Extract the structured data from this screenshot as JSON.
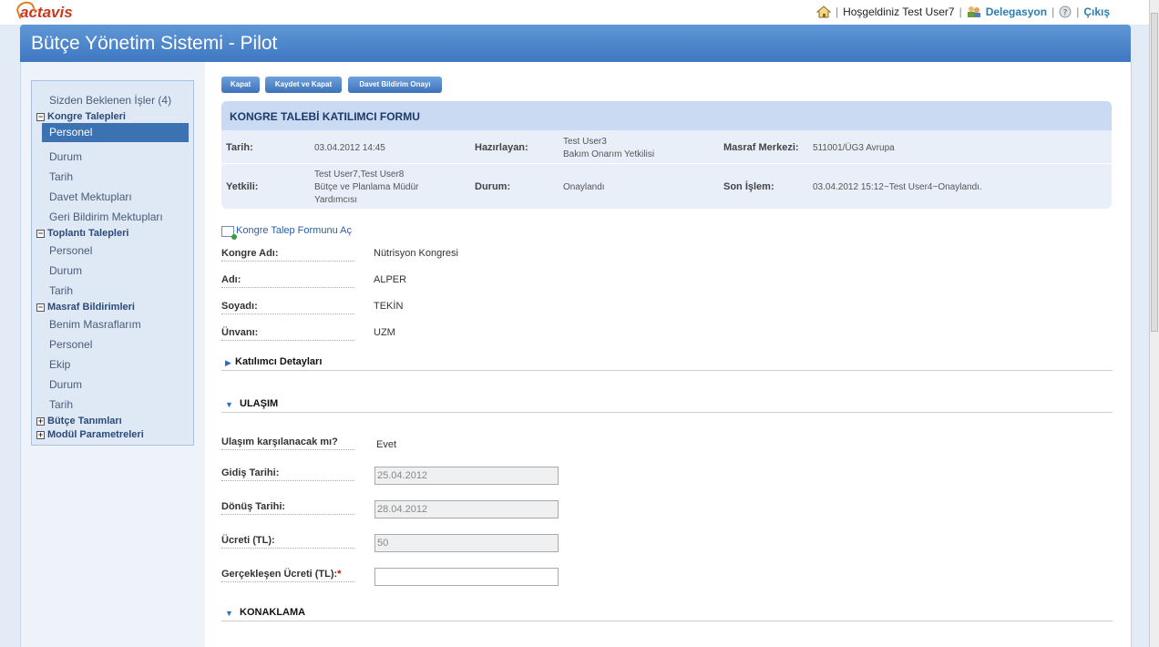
{
  "brand": {
    "logo_text": "actavis"
  },
  "top": {
    "welcome": "Hoşgeldiniz Test User7",
    "delegation": "Delegasyon",
    "logout": "Çıkış",
    "sep": "|"
  },
  "app": {
    "title": "Bütçe Yönetim Sistemi - Pilot"
  },
  "sidebar": {
    "pending": "Sizden Beklenen İşler (4)",
    "kongre": {
      "title": "Kongre Talepleri",
      "items": [
        "Personel",
        "Durum",
        "Tarih",
        "Davet Mektupları",
        "Geri Bildirim Mektupları"
      ]
    },
    "toplanti": {
      "title": "Toplantı Talepleri",
      "items": [
        "Personel",
        "Durum",
        "Tarih"
      ]
    },
    "masraf": {
      "title": "Masraf Bildirimleri",
      "items": [
        "Benim Masraflarım",
        "Personel",
        "Ekip",
        "Durum",
        "Tarih"
      ]
    },
    "butce": {
      "title": "Bütçe Tanımları"
    },
    "modul": {
      "title": "Modül Parametreleri"
    }
  },
  "toolbar": {
    "close": "Kapat",
    "save_close": "Kaydet ve Kapat",
    "invite_approve": "Davet Bildirim Onayı"
  },
  "panel": {
    "title": "KONGRE TALEBİ KATILIMCI FORMU",
    "tarih_label": "Tarih:",
    "tarih_value": "03.04.2012 14:45",
    "hazirlayan_label": "Hazırlayan:",
    "hazirlayan_name": "Test User3",
    "hazirlayan_role": "Bakım Onarım Yetkilisi",
    "masraf_label": "Masraf Merkezi:",
    "masraf_value": "511001/ÜG3 Avrupa",
    "yetkili_label": "Yetkili:",
    "yetkili_names": "Test User7,Test User8",
    "yetkili_role1": "Bütçe ve Planlama Müdür",
    "yetkili_role2": "Yardımcısı",
    "durum_label": "Durum:",
    "durum_value": "Onaylandı",
    "son_label": "Son İşlem:",
    "son_value": "03.04.2012 15:12~Test User4~Onaylandı."
  },
  "form": {
    "open_link": "Kongre Talep Formunu Aç",
    "kongre_label": "Kongre Adı:",
    "kongre_value": "Nütrisyon Kongresi",
    "ad_label": "Adı:",
    "ad_value": "ALPER",
    "soyad_label": "Soyadı:",
    "soyad_value": "TEKİN",
    "unvan_label": "Ünvanı:",
    "unvan_value": "UZM"
  },
  "sections": {
    "participant": "Katılımcı Detayları",
    "transport": "ULAŞIM",
    "lodging": "KONAKLAMA"
  },
  "transport": {
    "covered_label": "Ulaşım karşılanacak mı?",
    "covered_value": "Evet",
    "departure_label": "Gidiş Tarihi:",
    "departure_value": "25.04.2012",
    "return_label": "Dönüş Tarihi:",
    "return_value": "28.04.2012",
    "fee_label": "Ücreti (TL):",
    "fee_value": "50",
    "actual_label": "Gerçekleşen Ücreti (TL):",
    "required_mark": "*",
    "actual_value": ""
  }
}
